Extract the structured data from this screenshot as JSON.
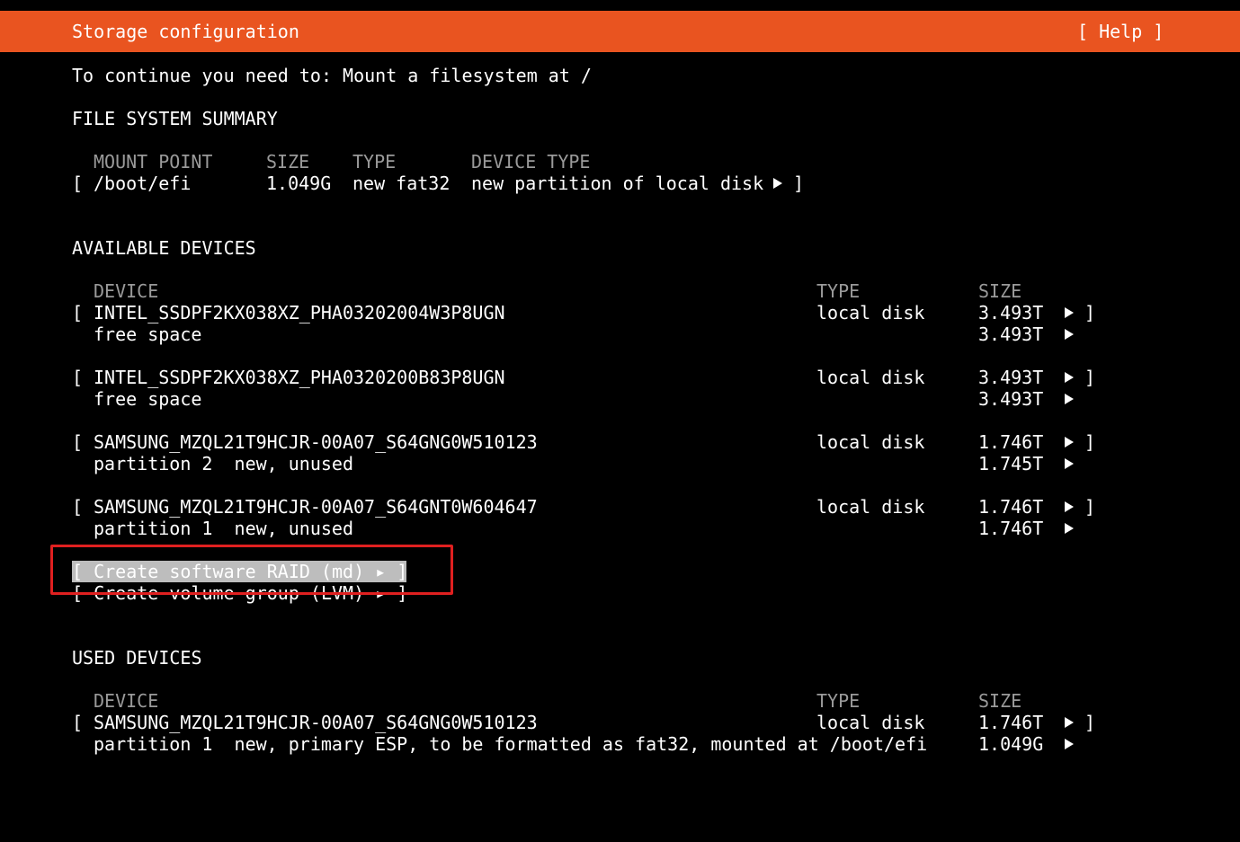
{
  "app": {
    "title": "Storage configuration",
    "help_label": "[ Help ]"
  },
  "colors": {
    "header_bg": "#e95420",
    "selection_bg": "#bdbdbd",
    "highlight_border": "#e02020"
  },
  "message": "To continue you need to: Mount a filesystem at /",
  "fs_summary": {
    "heading": "FILE SYSTEM SUMMARY",
    "headers": {
      "mount_point": "MOUNT POINT",
      "size": "SIZE",
      "type": "TYPE",
      "device_type": "DEVICE TYPE"
    },
    "row": {
      "open": "[",
      "mount_point": "/boot/efi",
      "size": "1.049G",
      "type": "new fat32",
      "device_type": "new partition of local disk",
      "close": "]"
    }
  },
  "available": {
    "heading": "AVAILABLE DEVICES",
    "headers": {
      "device": "DEVICE",
      "type": "TYPE",
      "size": "SIZE"
    },
    "devices": [
      {
        "open": "[",
        "name": "INTEL_SSDPF2KX038XZ_PHA03202004W3P8UGN",
        "type": "local disk",
        "size": "3.493T",
        "close": "]",
        "sub": "free space",
        "sub_size": "3.493T"
      },
      {
        "open": "[",
        "name": "INTEL_SSDPF2KX038XZ_PHA0320200B83P8UGN",
        "type": "local disk",
        "size": "3.493T",
        "close": "]",
        "sub": "free space",
        "sub_size": "3.493T"
      },
      {
        "open": "[",
        "name": "SAMSUNG_MZQL21T9HCJR-00A07_S64GNG0W510123",
        "type": "local disk",
        "size": "1.746T",
        "close": "]",
        "sub": "partition 2  new, unused",
        "sub_size": "1.745T"
      },
      {
        "open": "[",
        "name": "SAMSUNG_MZQL21T9HCJR-00A07_S64GNT0W604647",
        "type": "local disk",
        "size": "1.746T",
        "close": "]",
        "sub": "partition 1  new, unused",
        "sub_size": "1.746T"
      }
    ],
    "actions": {
      "raid_label": "[ Create software RAID (md) ▸ ]",
      "lvm_label": "[ Create volume group (LVM) ▸ ]"
    }
  },
  "used": {
    "heading": "USED DEVICES",
    "headers": {
      "device": "DEVICE",
      "type": "TYPE",
      "size": "SIZE"
    },
    "devices": [
      {
        "open": "[",
        "name": "SAMSUNG_MZQL21T9HCJR-00A07_S64GNG0W510123",
        "type": "local disk",
        "size": "1.746T",
        "close": "]",
        "sub": "partition 1  new, primary ESP, to be formatted as fat32, mounted at /boot/efi",
        "sub_size": "1.049G"
      }
    ]
  }
}
